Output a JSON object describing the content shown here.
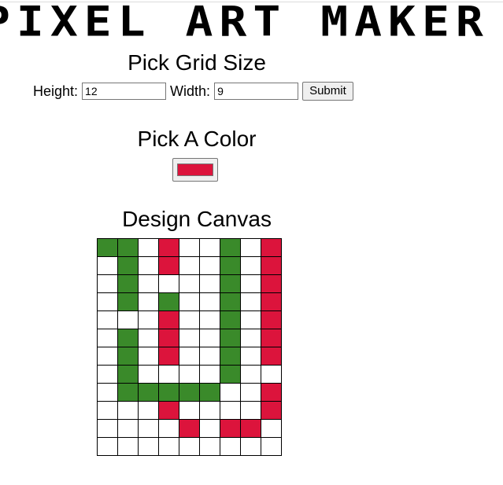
{
  "app": {
    "title": "PIXEL ART MAKER"
  },
  "grid_size": {
    "heading": "Pick Grid Size",
    "height_label": "Height:",
    "height_value": "12",
    "width_label": "Width:",
    "width_value": "9",
    "submit_label": "Submit"
  },
  "color": {
    "heading": "Pick A Color",
    "current": "#dc143c"
  },
  "canvas": {
    "heading": "Design Canvas",
    "palette": {
      "W": "#ffffff",
      "G": "#3a8a2a",
      "R": "#dc143c"
    },
    "rows": [
      "GGWRWWGWR",
      "WGWRWWGWR",
      "WGWWWWGWR",
      "WGWGWWGWR",
      "WWWRWWGWR",
      "WGWRWWGWR",
      "WGWRWWGWR",
      "WGWWWWGWW",
      "WGGGGGWWR",
      "WWWRWWWWR",
      "WWWWRWRRW",
      "WWWWWWWWW"
    ]
  }
}
